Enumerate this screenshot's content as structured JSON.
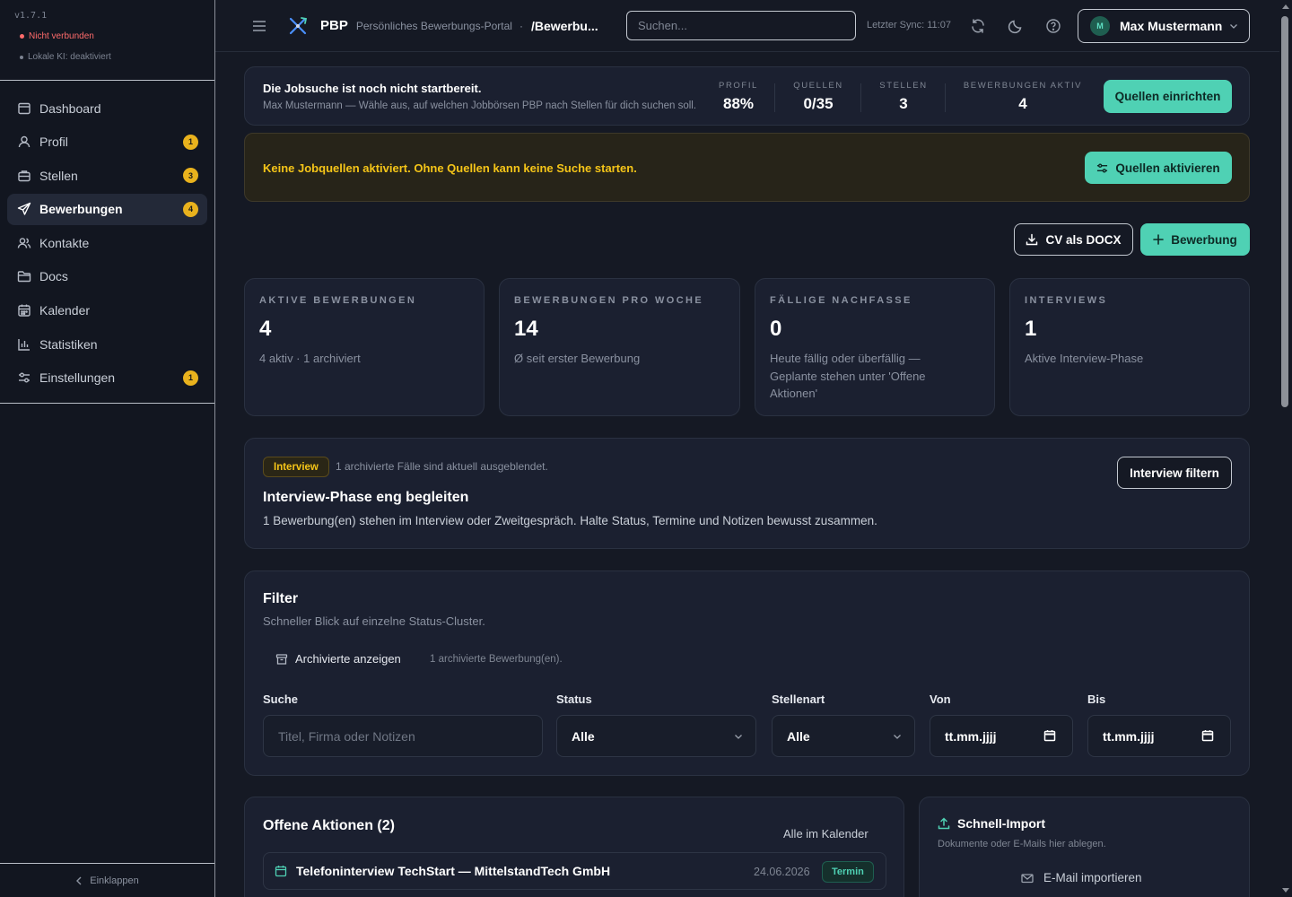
{
  "sidebar": {
    "version": "v1.7.1",
    "connection_status": "Nicht verbunden",
    "local_ai_status": "Lokale KI: deaktiviert",
    "items": [
      {
        "label": "Dashboard",
        "icon": "dashboard-icon",
        "badge": null
      },
      {
        "label": "Profil",
        "icon": "user-icon",
        "badge": "1"
      },
      {
        "label": "Stellen",
        "icon": "briefcase-icon",
        "badge": "3"
      },
      {
        "label": "Bewerbungen",
        "icon": "send-icon",
        "badge": "4",
        "active": true
      },
      {
        "label": "Kontakte",
        "icon": "contacts-icon",
        "badge": null
      },
      {
        "label": "Docs",
        "icon": "folder-icon",
        "badge": null
      },
      {
        "label": "Kalender",
        "icon": "calendar-icon",
        "badge": null
      },
      {
        "label": "Statistiken",
        "icon": "bar-chart-icon",
        "badge": null
      },
      {
        "label": "Einstellungen",
        "icon": "sliders-icon",
        "badge": "1"
      }
    ],
    "collapse_label": "Einklappen"
  },
  "topbar": {
    "brand": "PBP",
    "brand_subtitle": "Persönliches Bewerbungs-Portal",
    "breadcrumb_separator": "·",
    "breadcrumb": "/Bewerbu...",
    "search_placeholder": "Suchen...",
    "sync": "Letzter Sync: 11:07",
    "user_initial": "M",
    "user_name": "Max Mustermann"
  },
  "status_card": {
    "title": "Die Jobsuche ist noch nicht startbereit.",
    "subtitle": "Max Mustermann — Wähle aus, auf welchen Jobbörsen PBP nach Stellen für dich suchen soll.",
    "kpis": [
      {
        "label": "PROFIL",
        "value": "88%"
      },
      {
        "label": "QUELLEN",
        "value": "0/35"
      },
      {
        "label": "STELLEN",
        "value": "3"
      },
      {
        "label": "BEWERBUNGEN AKTIV",
        "value": "4"
      }
    ],
    "button": "Quellen einrichten"
  },
  "warning": {
    "text": "Keine Jobquellen aktiviert. Ohne Quellen kann keine Suche starten.",
    "button": "Quellen aktivieren"
  },
  "actions": {
    "cv_button": "CV als DOCX",
    "new_button": "Bewerbung"
  },
  "stats": [
    {
      "label": "AKTIVE BEWERBUNGEN",
      "value": "4",
      "sub": "4 aktiv · 1 archiviert"
    },
    {
      "label": "BEWERBUNGEN PRO WOCHE",
      "value": "14",
      "sub": "Ø seit erster Bewerbung"
    },
    {
      "label": "FÄLLIGE NACHFASSE",
      "value": "0",
      "sub": "Heute fällig oder überfällig — Geplante stehen unter 'Offene Aktionen'"
    },
    {
      "label": "INTERVIEWS",
      "value": "1",
      "sub": "Aktive Interview-Phase"
    }
  ],
  "interview": {
    "pill": "Interview",
    "archived_note": "1 archivierte Fälle sind aktuell ausgeblendet.",
    "title": "Interview-Phase eng begleiten",
    "text": "1 Bewerbung(en) stehen im Interview oder Zweitgespräch. Halte Status, Termine und Notizen bewusst zusammen.",
    "button": "Interview filtern"
  },
  "filter": {
    "title": "Filter",
    "subtitle": "Schneller Blick auf einzelne Status-Cluster.",
    "archived_toggle": "Archivierte anzeigen",
    "archived_note": "1 archivierte Bewerbung(en).",
    "search_label": "Suche",
    "search_placeholder": "Titel, Firma oder Notizen",
    "status_label": "Status",
    "status_value": "Alle",
    "type_label": "Stellenart",
    "type_value": "Alle",
    "from_label": "Von",
    "from_value": "tt.mm.jjjj",
    "to_label": "Bis",
    "to_value": "tt.mm.jjjj"
  },
  "open_actions": {
    "title": "Offene Aktionen (2)",
    "calendar_link": "Alle im Kalender",
    "items": [
      {
        "title": "Telefoninterview TechStart — MittelstandTech GmbH",
        "date": "24.06.2026",
        "tag": "Termin"
      }
    ]
  },
  "quick_import": {
    "title": "Schnell-Import",
    "subtitle": "Dokumente oder E-Mails hier ablegen.",
    "mail_button": "E-Mail importieren"
  },
  "colors": {
    "accent": "#4fd1b4",
    "warning": "#f5c518",
    "error": "#ff6b6b",
    "badge": "#e9b21d",
    "background": "#151924",
    "card": "#1b2030"
  }
}
